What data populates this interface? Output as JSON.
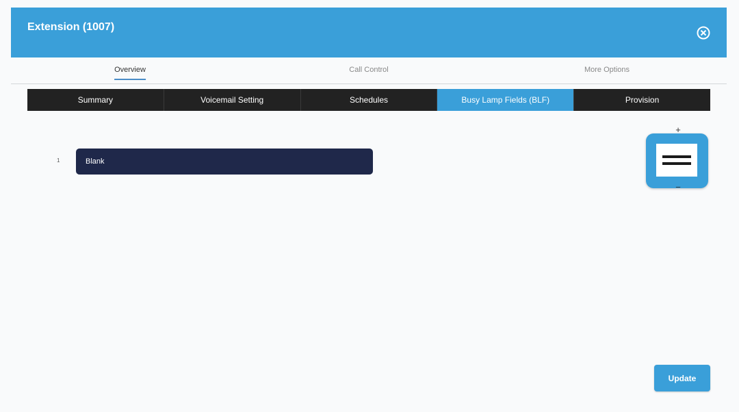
{
  "header": {
    "title": "Extension (1007)",
    "close_icon": "close-circle-icon"
  },
  "subtabs": [
    {
      "label": "Overview",
      "active": true
    },
    {
      "label": "Call Control",
      "active": false
    },
    {
      "label": "More Options",
      "active": false
    }
  ],
  "tabs": [
    {
      "label": "Summary",
      "active": false
    },
    {
      "label": "Voicemail Setting",
      "active": false
    },
    {
      "label": "Schedules",
      "active": false
    },
    {
      "label": "Busy Lamp Fields (BLF)",
      "active": true
    },
    {
      "label": "Provision",
      "active": false
    }
  ],
  "blf": {
    "index": "1",
    "value": "Blank"
  },
  "zoom": {
    "plus": "+",
    "minus": "−",
    "menu_icon": "hamburger-menu-icon"
  },
  "actions": {
    "update_label": "Update"
  },
  "colors": {
    "accent": "#3a9fd9",
    "tab_bg": "#222222",
    "field_bg": "#1f284a"
  }
}
